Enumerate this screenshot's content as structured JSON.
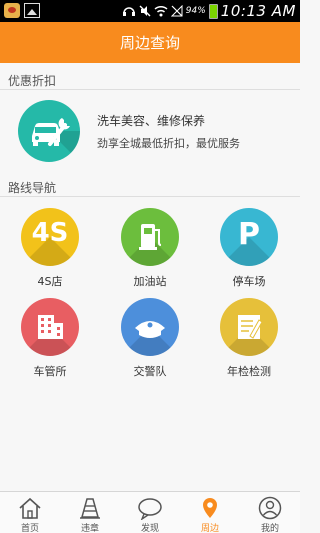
{
  "status_bar": {
    "battery_percent": "94%",
    "time": "10:13 AM",
    "icons": [
      "app-notification-icon",
      "image-icon",
      "headset-icon",
      "mute-icon",
      "wifi-icon",
      "no-signal-icon",
      "battery-icon"
    ]
  },
  "header": {
    "title": "周边查询"
  },
  "discount_section": {
    "label": "优惠折扣",
    "promo": {
      "icon": "car-wrench-icon",
      "title": "洗车美容、维修保养",
      "subtitle": "劲享全城最低折扣，最优服务",
      "color": "#25b9a8"
    }
  },
  "route_section": {
    "label": "路线导航",
    "items": [
      {
        "label": "4S店",
        "icon_text": "4S",
        "icon": "4s-icon",
        "color": "#f2c21a"
      },
      {
        "label": "加油站",
        "icon": "fuel-pump-icon",
        "color": "#6cbe3d"
      },
      {
        "label": "停车场",
        "icon_text": "P",
        "icon": "parking-icon",
        "color": "#38b7d2"
      },
      {
        "label": "车管所",
        "icon": "building-icon",
        "color": "#e85e62"
      },
      {
        "label": "交警队",
        "icon": "police-cap-icon",
        "color": "#4d8fdb"
      },
      {
        "label": "年检检测",
        "icon": "inspection-document-icon",
        "color": "#e6c03a"
      }
    ]
  },
  "tab_bar": {
    "active_color": "#f88b1e",
    "tabs": [
      {
        "label": "首页",
        "icon": "home-icon"
      },
      {
        "label": "违章",
        "icon": "traffic-cone-icon"
      },
      {
        "label": "发现",
        "icon": "chat-bubble-icon"
      },
      {
        "label": "周边",
        "icon": "location-pin-icon",
        "active": true
      },
      {
        "label": "我的",
        "icon": "user-icon"
      }
    ]
  }
}
